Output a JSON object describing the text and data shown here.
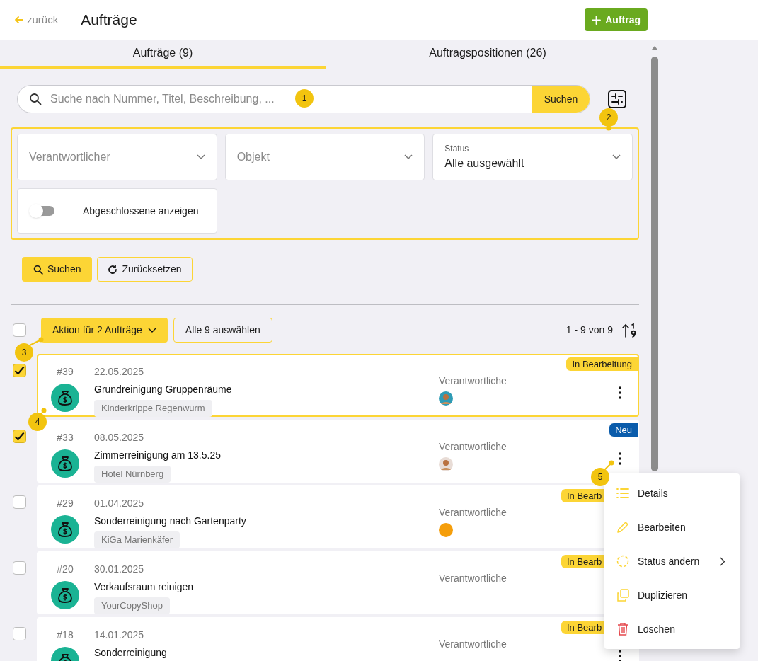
{
  "header": {
    "back": "zurück",
    "title": "Aufträge",
    "add_button": "Auftrag"
  },
  "tabs": [
    {
      "label": "Aufträge (9)",
      "selected": true
    },
    {
      "label": "Auftragspositionen (26)",
      "selected": false
    }
  ],
  "search": {
    "placeholder": "Suche nach Nummer, Titel, Beschreibung, ...",
    "button": "Suchen"
  },
  "filters": {
    "highlighted": true,
    "dropdowns": [
      {
        "placeholder": "Verantwortlicher"
      },
      {
        "placeholder": "Objekt"
      },
      {
        "label": "Status",
        "value": "Alle ausgewählt"
      }
    ],
    "toggle": {
      "label": "Abgeschlossene anzeigen",
      "on": false
    }
  },
  "filter_buttons": {
    "search": "Suchen",
    "reset": "Zurücksetzen"
  },
  "toolbar": {
    "select_all_checked": false,
    "action": "Aktion für 2 Aufträge",
    "select_all": "Alle 9 auswählen",
    "range": "1 - 9 von 9"
  },
  "orders": [
    {
      "number": "#39",
      "date": "22.05.2025",
      "title": "Grundreinigung Gruppenräume",
      "object": "Kinderkrippe Regenwurm",
      "responsible_label": "Verantwortliche",
      "avatar": {
        "kind": "photo",
        "color": "#2e9bb5"
      },
      "status": "In Bearbeitung",
      "color": "#fcd535",
      "checked": true,
      "highlighted": true,
      "menu_hidden": false
    },
    {
      "number": "#33",
      "date": "08.05.2025",
      "title": "Zimmerreinigung am 13.5.25",
      "object": "Hotel Nürnberg",
      "responsible_label": "Verantwortliche",
      "avatar": {
        "kind": "photo",
        "color": "#e8dcd6"
      },
      "status": "Neu",
      "color": "#0b5cab",
      "checked": true,
      "highlighted": false,
      "menu_hidden": false
    },
    {
      "number": "#29",
      "date": "01.04.2025",
      "title": "Sonderreinigung nach Gartenparty",
      "object": "KiGa Marienkäfer",
      "responsible_label": "Verantwortliche",
      "avatar": {
        "kind": "emoji",
        "color": "#f59e0b"
      },
      "status": "In Bearb",
      "color": "#fcd535",
      "checked": false,
      "highlighted": false,
      "menu_hidden": true,
      "badge_covered": true
    },
    {
      "number": "#20",
      "date": "30.01.2025",
      "title": "Verkaufsraum reinigen",
      "object": "YourCopyShop",
      "responsible_label": "Verantwortliche",
      "status": "In Bearb",
      "color": "#fcd535",
      "checked": false,
      "highlighted": false,
      "menu_hidden": true,
      "badge_covered": true
    },
    {
      "number": "#18",
      "date": "14.01.2025",
      "title": "Sonderreinigung",
      "responsible_label": "Verantwortliche",
      "status": "In Bearb",
      "color": "#fcd535",
      "checked": false,
      "highlighted": false,
      "menu_hidden": false,
      "badge_covered": true
    }
  ],
  "context_menu": [
    {
      "kind": "details",
      "label": "Details"
    },
    {
      "kind": "edit",
      "label": "Bearbeiten"
    },
    {
      "kind": "status",
      "label": "Status ändern",
      "submenu": true
    },
    {
      "kind": "duplicate",
      "label": "Duplizieren"
    },
    {
      "kind": "delete",
      "label": "Löschen"
    }
  ],
  "callouts": [
    {
      "label": "1"
    },
    {
      "label": "2"
    },
    {
      "label": "3"
    },
    {
      "label": "4"
    },
    {
      "label": "5"
    }
  ]
}
